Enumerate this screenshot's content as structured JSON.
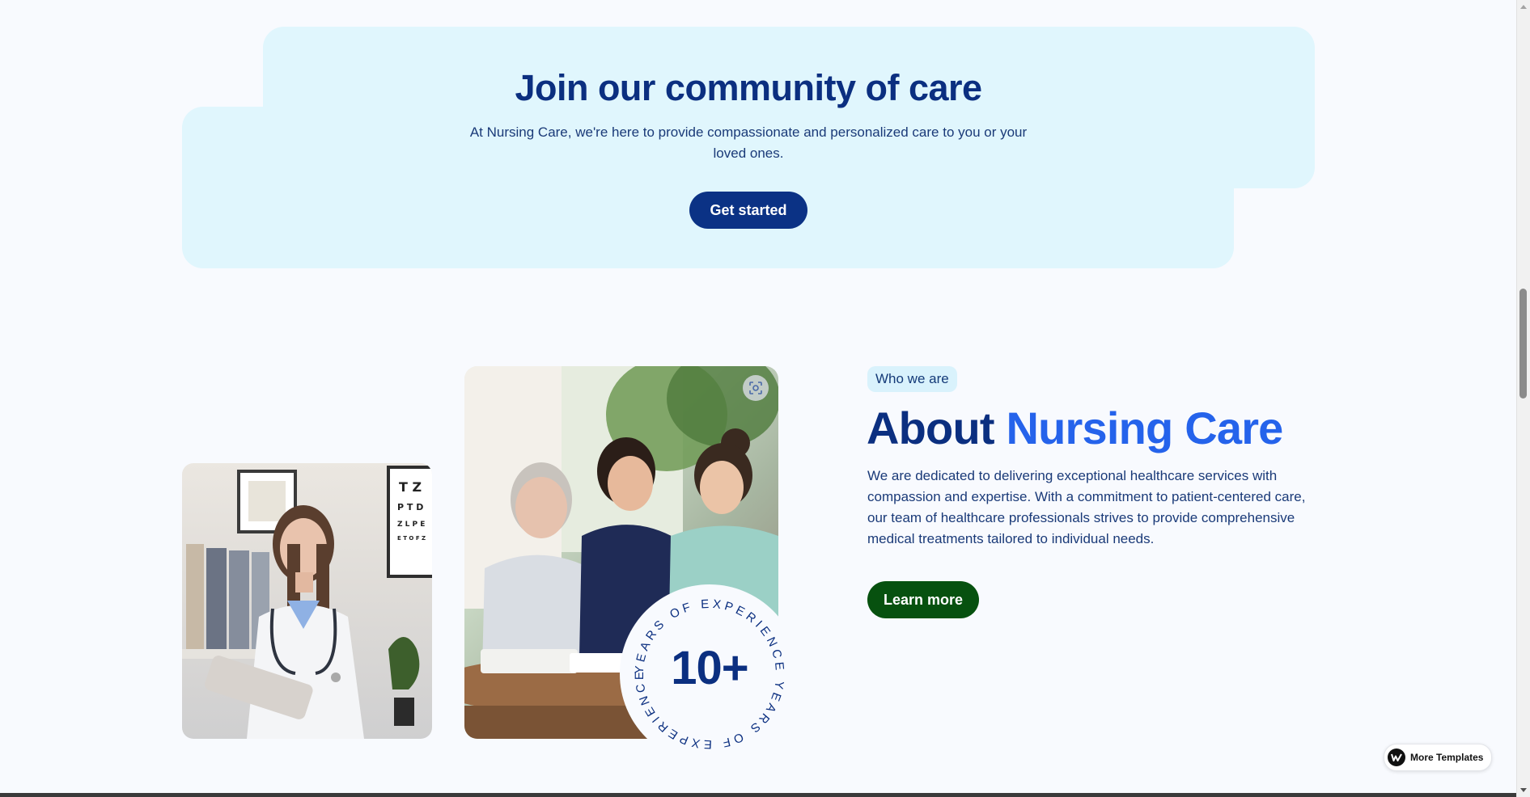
{
  "cta": {
    "title": "Join our community of care",
    "text": "At Nursing Care, we're here to provide compassionate and personalized care to you or your loved ones.",
    "button_label": "Get started"
  },
  "about": {
    "tag": "Who we are",
    "title_part1": "About ",
    "title_part2": "Nursing Care",
    "text": "We are dedicated to delivering exceptional healthcare services with compassion and expertise. With a commitment to patient-centered care, our team of healthcare professionals strives to provide comprehensive medical treatments tailored to individual needs.",
    "button_label": "Learn more",
    "badge_number": "10+",
    "badge_ring_text": "YEARS OF EXPERIENCE YEARS OF EXPERIENCE"
  },
  "images": {
    "nurse_icon": "nurse-photo",
    "group_icon": "caregivers-photo",
    "lens_icon": "visual-search-icon"
  },
  "more_templates": {
    "label": "More Templates"
  },
  "colors": {
    "navy": "#0b2f80",
    "accent_blue": "#2563eb",
    "cta_bg": "#e0f6fd",
    "learn_green": "#07510f",
    "page_bg": "#f8fafe"
  }
}
